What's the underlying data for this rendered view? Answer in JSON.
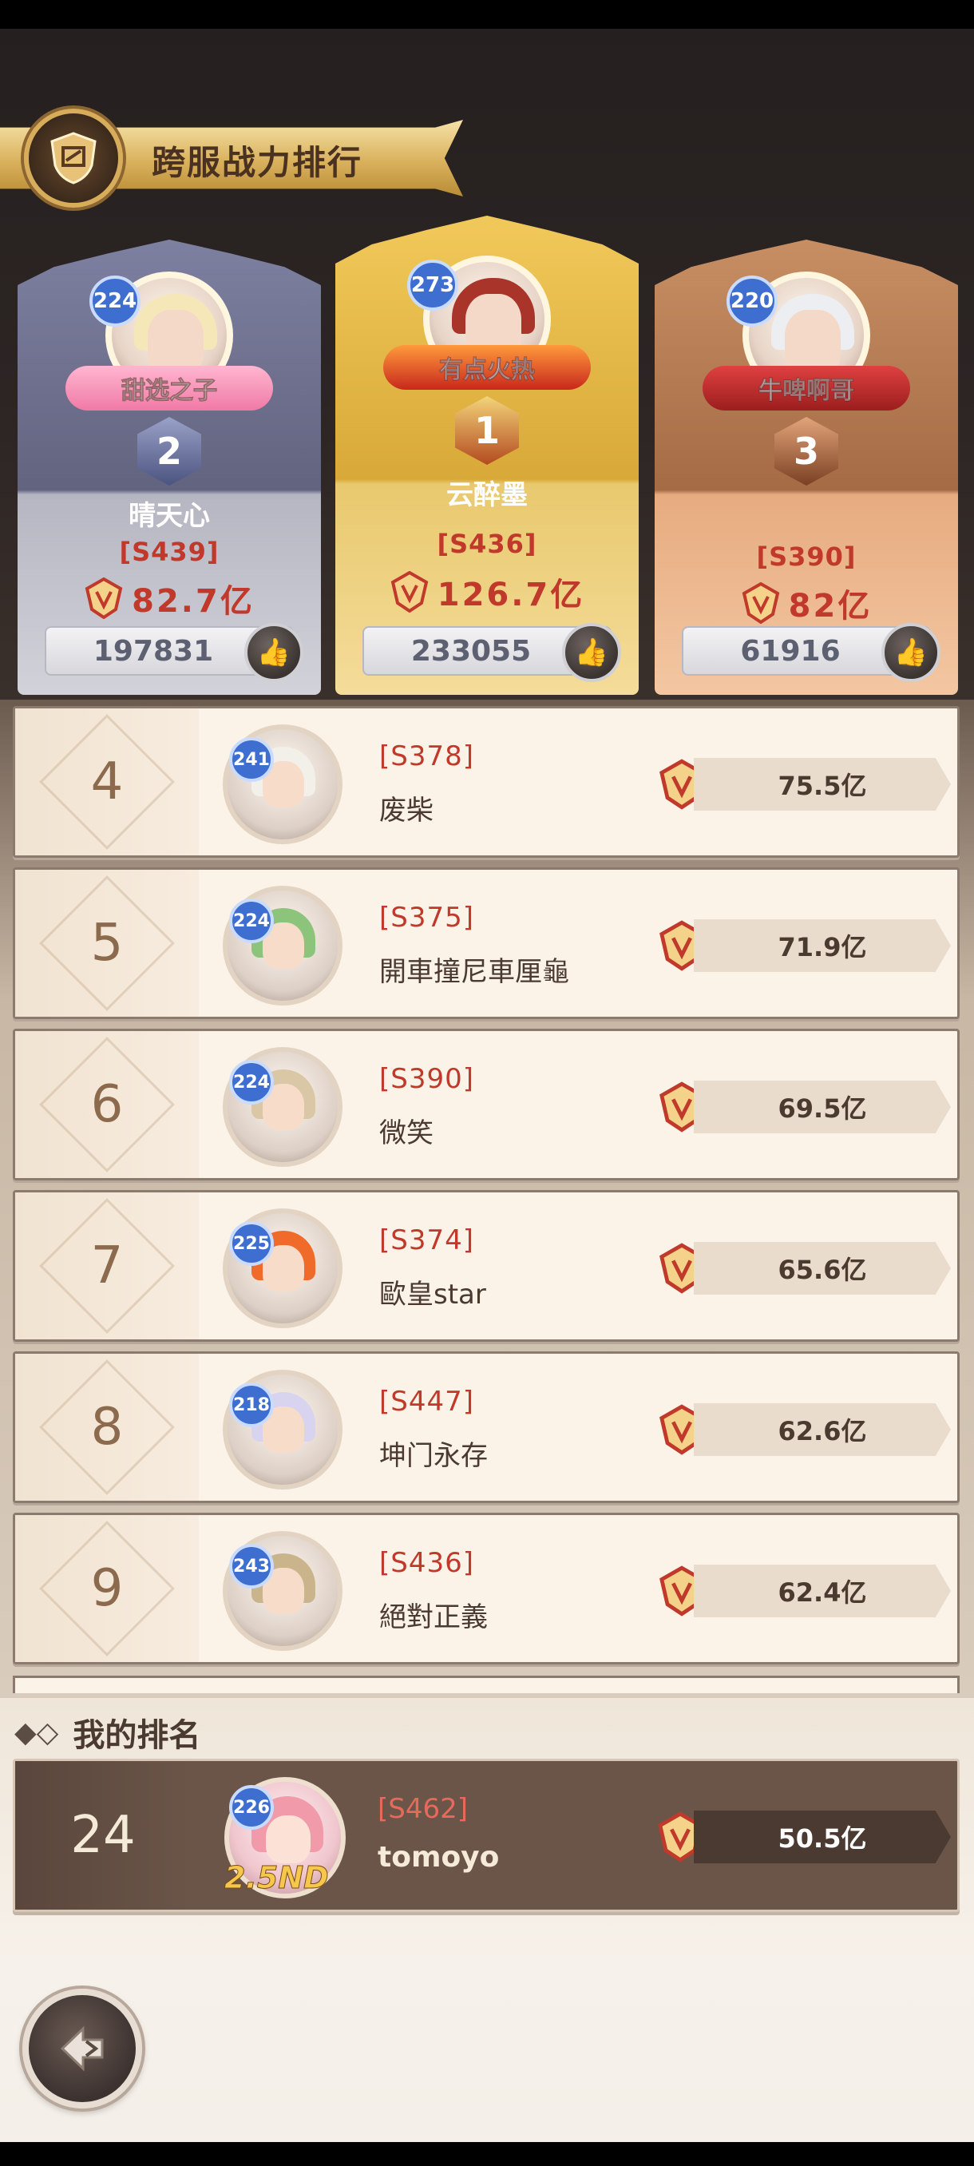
{
  "header": {
    "title": "跨服战力排行"
  },
  "podium": [
    {
      "rank": "2",
      "level": "224",
      "title_tag": "甜选之子",
      "name": "晴天心",
      "server": "[S439]",
      "power": "82.7亿",
      "likes": "197831",
      "style": "silver"
    },
    {
      "rank": "1",
      "level": "273",
      "title_tag": "有点火热",
      "name": "云醉墨",
      "server": "[S436]",
      "power": "126.7亿",
      "likes": "233055",
      "style": "gold"
    },
    {
      "rank": "3",
      "level": "220",
      "title_tag": "牛啤啊哥",
      "name": "",
      "server": "[S390]",
      "power": "82亿",
      "likes": "61916",
      "style": "bronze"
    }
  ],
  "rankings": [
    {
      "rank": "4",
      "level": "241",
      "server": "[S378]",
      "name": "废柴",
      "power": "75.5亿"
    },
    {
      "rank": "5",
      "level": "224",
      "server": "[S375]",
      "name": "開車撞尼車厘龜",
      "power": "71.9亿"
    },
    {
      "rank": "6",
      "level": "224",
      "server": "[S390]",
      "name": "微笑",
      "power": "69.5亿"
    },
    {
      "rank": "7",
      "level": "225",
      "server": "[S374]",
      "name": "歐皇star",
      "power": "65.6亿"
    },
    {
      "rank": "8",
      "level": "218",
      "server": "[S447]",
      "name": "坤门永存",
      "power": "62.6亿"
    },
    {
      "rank": "9",
      "level": "243",
      "server": "[S436]",
      "name": "絕對正義",
      "power": "62.4亿"
    }
  ],
  "my_ranking": {
    "label": "我的排名",
    "rank": "24",
    "level": "226",
    "tag": "2.5ND",
    "server": "[S462]",
    "name": "tomoyo",
    "power": "50.5亿"
  },
  "icons": {
    "emblem": "power-crest-icon",
    "like": "thumbs-up-icon",
    "back": "back-arrow-icon",
    "section": "double-diamond-icon"
  },
  "colors": {
    "accent_red": "#c0392b",
    "level_blue": "#3f6ed1",
    "gold": "#d8a938"
  }
}
